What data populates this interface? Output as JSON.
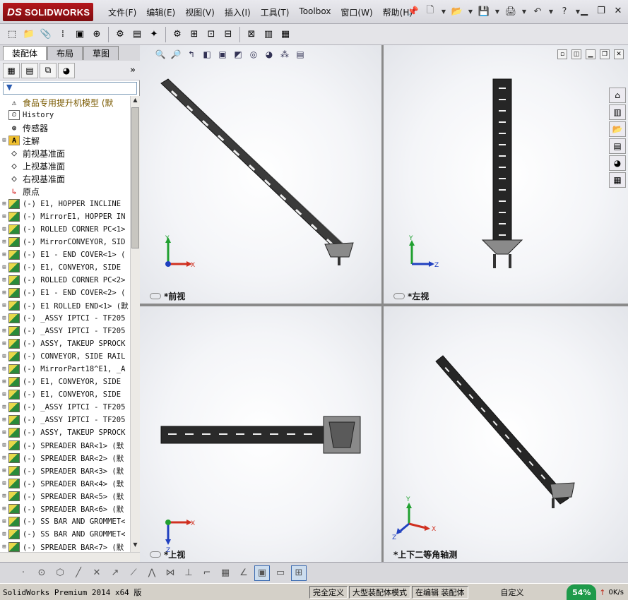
{
  "app": {
    "logo_ds": "DS",
    "logo_name": "SOLIDWORKS"
  },
  "menu": [
    "文件(F)",
    "编辑(E)",
    "视图(V)",
    "插入(I)",
    "工具(T)",
    "Toolbox",
    "窗口(W)",
    "帮助(H)"
  ],
  "panel": {
    "tabs": [
      "装配体",
      "布局",
      "草图"
    ],
    "active_tab": "装配体",
    "filter_icon": "filter-icon",
    "expand_label": "»"
  },
  "tree": [
    {
      "icon": "assembly",
      "label": "食品专用提升机模型 (默",
      "kind": "top",
      "exp": ""
    },
    {
      "icon": "hist",
      "label": "History",
      "kind": "mono",
      "exp": ""
    },
    {
      "icon": "sensor",
      "label": "传感器",
      "kind": "cjk",
      "exp": ""
    },
    {
      "icon": "anno",
      "label": "注解",
      "kind": "cjk",
      "exp": "+"
    },
    {
      "icon": "plane",
      "label": "前视基准面",
      "kind": "cjk",
      "exp": ""
    },
    {
      "icon": "plane",
      "label": "上视基准面",
      "kind": "cjk",
      "exp": ""
    },
    {
      "icon": "plane",
      "label": "右视基准面",
      "kind": "cjk",
      "exp": ""
    },
    {
      "icon": "origin",
      "label": "原点",
      "kind": "cjk",
      "exp": ""
    },
    {
      "icon": "part",
      "label": "(-) E1, HOPPER INCLINE",
      "kind": "mono",
      "exp": "+"
    },
    {
      "icon": "part",
      "label": "(-) MirrorE1, HOPPER IN",
      "kind": "mono",
      "exp": "+"
    },
    {
      "icon": "part",
      "label": "(-) ROLLED CORNER PC<1>",
      "kind": "mono",
      "exp": "+"
    },
    {
      "icon": "part",
      "label": "(-) MirrorCONVEYOR, SID",
      "kind": "mono",
      "exp": "+"
    },
    {
      "icon": "part",
      "label": "(-) E1 - END COVER<1> (",
      "kind": "mono",
      "exp": "+"
    },
    {
      "icon": "part",
      "label": "(-) E1, CONVEYOR, SIDE",
      "kind": "mono",
      "exp": "+"
    },
    {
      "icon": "part",
      "label": "(-) ROLLED CORNER PC<2>",
      "kind": "mono",
      "exp": "+"
    },
    {
      "icon": "part",
      "label": "(-) E1 - END COVER<2> (",
      "kind": "mono",
      "exp": "+"
    },
    {
      "icon": "part",
      "label": "(-) E1 ROLLED END<1> (默",
      "kind": "mono",
      "exp": "+"
    },
    {
      "icon": "part",
      "label": "(-) _ASSY IPTCI - TF205",
      "kind": "mono",
      "exp": "+"
    },
    {
      "icon": "part",
      "label": "(-) _ASSY IPTCI - TF205",
      "kind": "mono",
      "exp": "+"
    },
    {
      "icon": "part",
      "label": "(-) ASSY, TAKEUP SPROCK",
      "kind": "mono",
      "exp": "+"
    },
    {
      "icon": "part",
      "label": "(-) CONVEYOR, SIDE RAIL",
      "kind": "mono",
      "exp": "+"
    },
    {
      "icon": "part",
      "label": "(-) MirrorPart18^E1, _A",
      "kind": "mono",
      "exp": "+"
    },
    {
      "icon": "part",
      "label": "(-) E1, CONVEYOR, SIDE",
      "kind": "mono",
      "exp": "+"
    },
    {
      "icon": "part",
      "label": "(-) E1, CONVEYOR, SIDE",
      "kind": "mono",
      "exp": "+"
    },
    {
      "icon": "part",
      "label": "(-) _ASSY IPTCI - TF205",
      "kind": "mono",
      "exp": "+"
    },
    {
      "icon": "part",
      "label": "(-) _ASSY IPTCI - TF205",
      "kind": "mono",
      "exp": "+"
    },
    {
      "icon": "part",
      "label": "(-) ASSY, TAKEUP SPROCK",
      "kind": "mono",
      "exp": "+"
    },
    {
      "icon": "part",
      "label": "(-) SPREADER BAR<1> (默",
      "kind": "mono",
      "exp": "+"
    },
    {
      "icon": "part",
      "label": "(-) SPREADER BAR<2> (默",
      "kind": "mono",
      "exp": "+"
    },
    {
      "icon": "part",
      "label": "(-) SPREADER BAR<3> (默",
      "kind": "mono",
      "exp": "+"
    },
    {
      "icon": "part",
      "label": "(-) SPREADER BAR<4> (默",
      "kind": "mono",
      "exp": "+"
    },
    {
      "icon": "part",
      "label": "(-) SPREADER BAR<5> (默",
      "kind": "mono",
      "exp": "+"
    },
    {
      "icon": "part",
      "label": "(-) SPREADER BAR<6> (默",
      "kind": "mono",
      "exp": "+"
    },
    {
      "icon": "part",
      "label": "(-) SS BAR AND GROMMET<",
      "kind": "mono",
      "exp": "+"
    },
    {
      "icon": "part",
      "label": "(-) SS BAR AND GROMMET<",
      "kind": "mono",
      "exp": "+"
    },
    {
      "icon": "part",
      "label": "(-) SPREADER BAR<7> (默",
      "kind": "mono",
      "exp": "+"
    }
  ],
  "viewports": {
    "front": {
      "label": "*前视",
      "axes": [
        "Y",
        "X"
      ]
    },
    "left": {
      "label": "*左视",
      "axes": [
        "Y",
        "Z"
      ]
    },
    "top": {
      "label": "*上视",
      "axes": [
        "X",
        "Z"
      ]
    },
    "iso": {
      "label": "*上下二等角轴测",
      "axes": [
        "Y",
        "X",
        "Z"
      ]
    }
  },
  "status": {
    "main": "SolidWorks Premium 2014 x64 版",
    "defined": "完全定义",
    "large_mode": "大型装配体模式",
    "editing": "在编辑 装配体",
    "custom": "自定义",
    "net_pct": "54%",
    "net_speed": "0K/s"
  },
  "colors": {
    "accent": "#b5161c",
    "axis_x": "#d03020",
    "axis_y": "#20a030",
    "axis_z": "#2040c0",
    "status_ok": "#1e9a4a"
  }
}
